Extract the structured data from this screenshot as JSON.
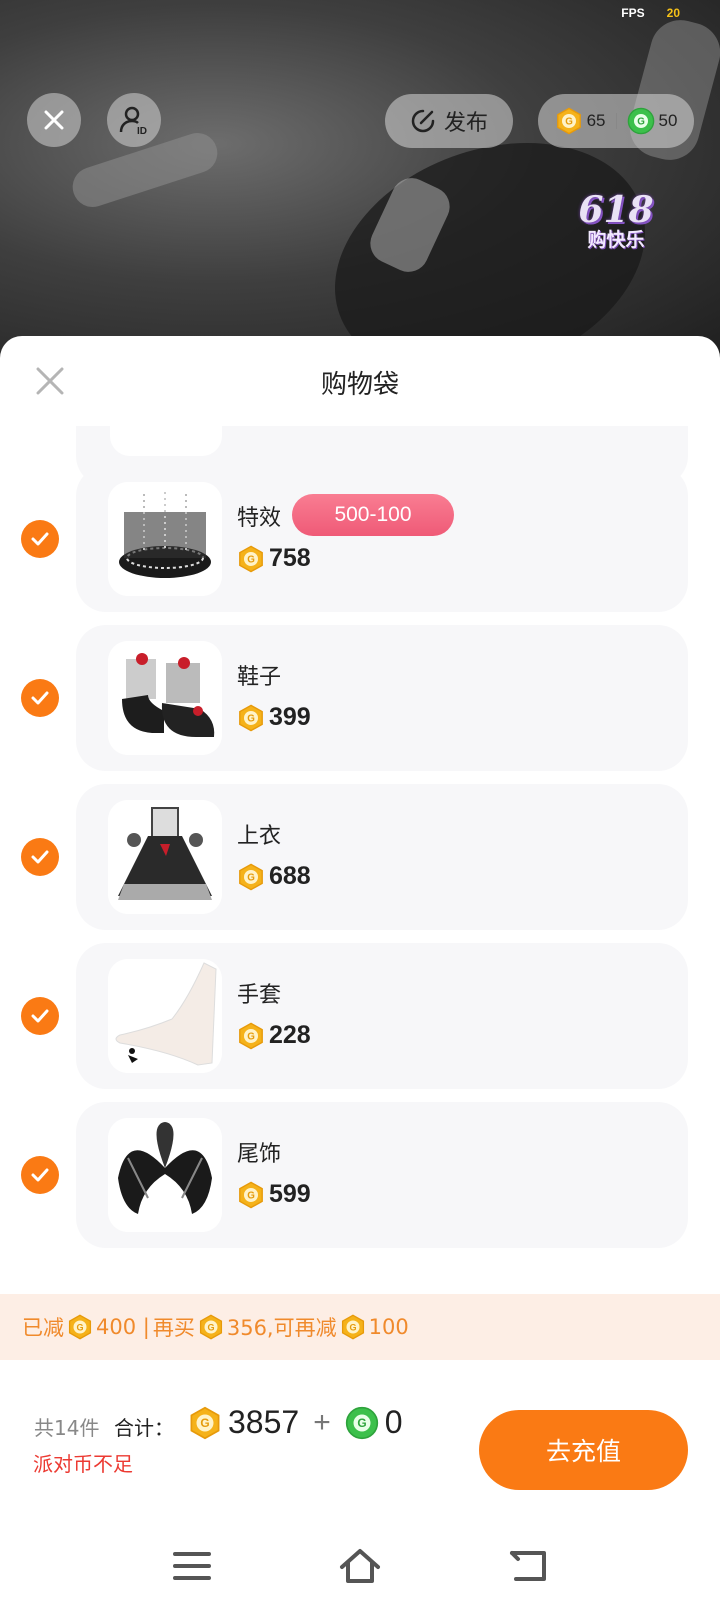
{
  "hud": {
    "fps_label": "FPS",
    "fps_value": "20"
  },
  "topbar": {
    "publish_label": "发布",
    "gold_balance": "65",
    "green_balance": "50"
  },
  "promo": {
    "big": "618",
    "small": "购快乐"
  },
  "sheet": {
    "title": "购物袋",
    "items": [
      {
        "name": "特效",
        "price": "758",
        "badge": "500-100",
        "checked": true,
        "icon": "effect-ring"
      },
      {
        "name": "鞋子",
        "price": "399",
        "checked": true,
        "icon": "lolita-shoes"
      },
      {
        "name": "上衣",
        "price": "688",
        "checked": true,
        "icon": "lolita-dress"
      },
      {
        "name": "手套",
        "price": "228",
        "checked": true,
        "icon": "white-glove"
      },
      {
        "name": "尾饰",
        "price": "599",
        "checked": true,
        "icon": "feather-tail"
      }
    ]
  },
  "discount": {
    "reduced_label": "已减",
    "reduced_value": "400 |",
    "buy_more_label": "再买",
    "buy_more_value": "356,可再减",
    "next_reduce_value": "100"
  },
  "footer": {
    "count_label": "共14件",
    "total_label": "合计：",
    "gold_total": "3857",
    "plus": "+",
    "green_total": "0",
    "warning": "派对币不足",
    "recharge_label": "去充值"
  },
  "colors": {
    "accent": "#fa7a14",
    "badge": "#ef5a77",
    "warning": "#ec3a32",
    "discount_bg": "#fdeee5",
    "coin_gold": "#f5b21a",
    "coin_green": "#3cc04b"
  }
}
